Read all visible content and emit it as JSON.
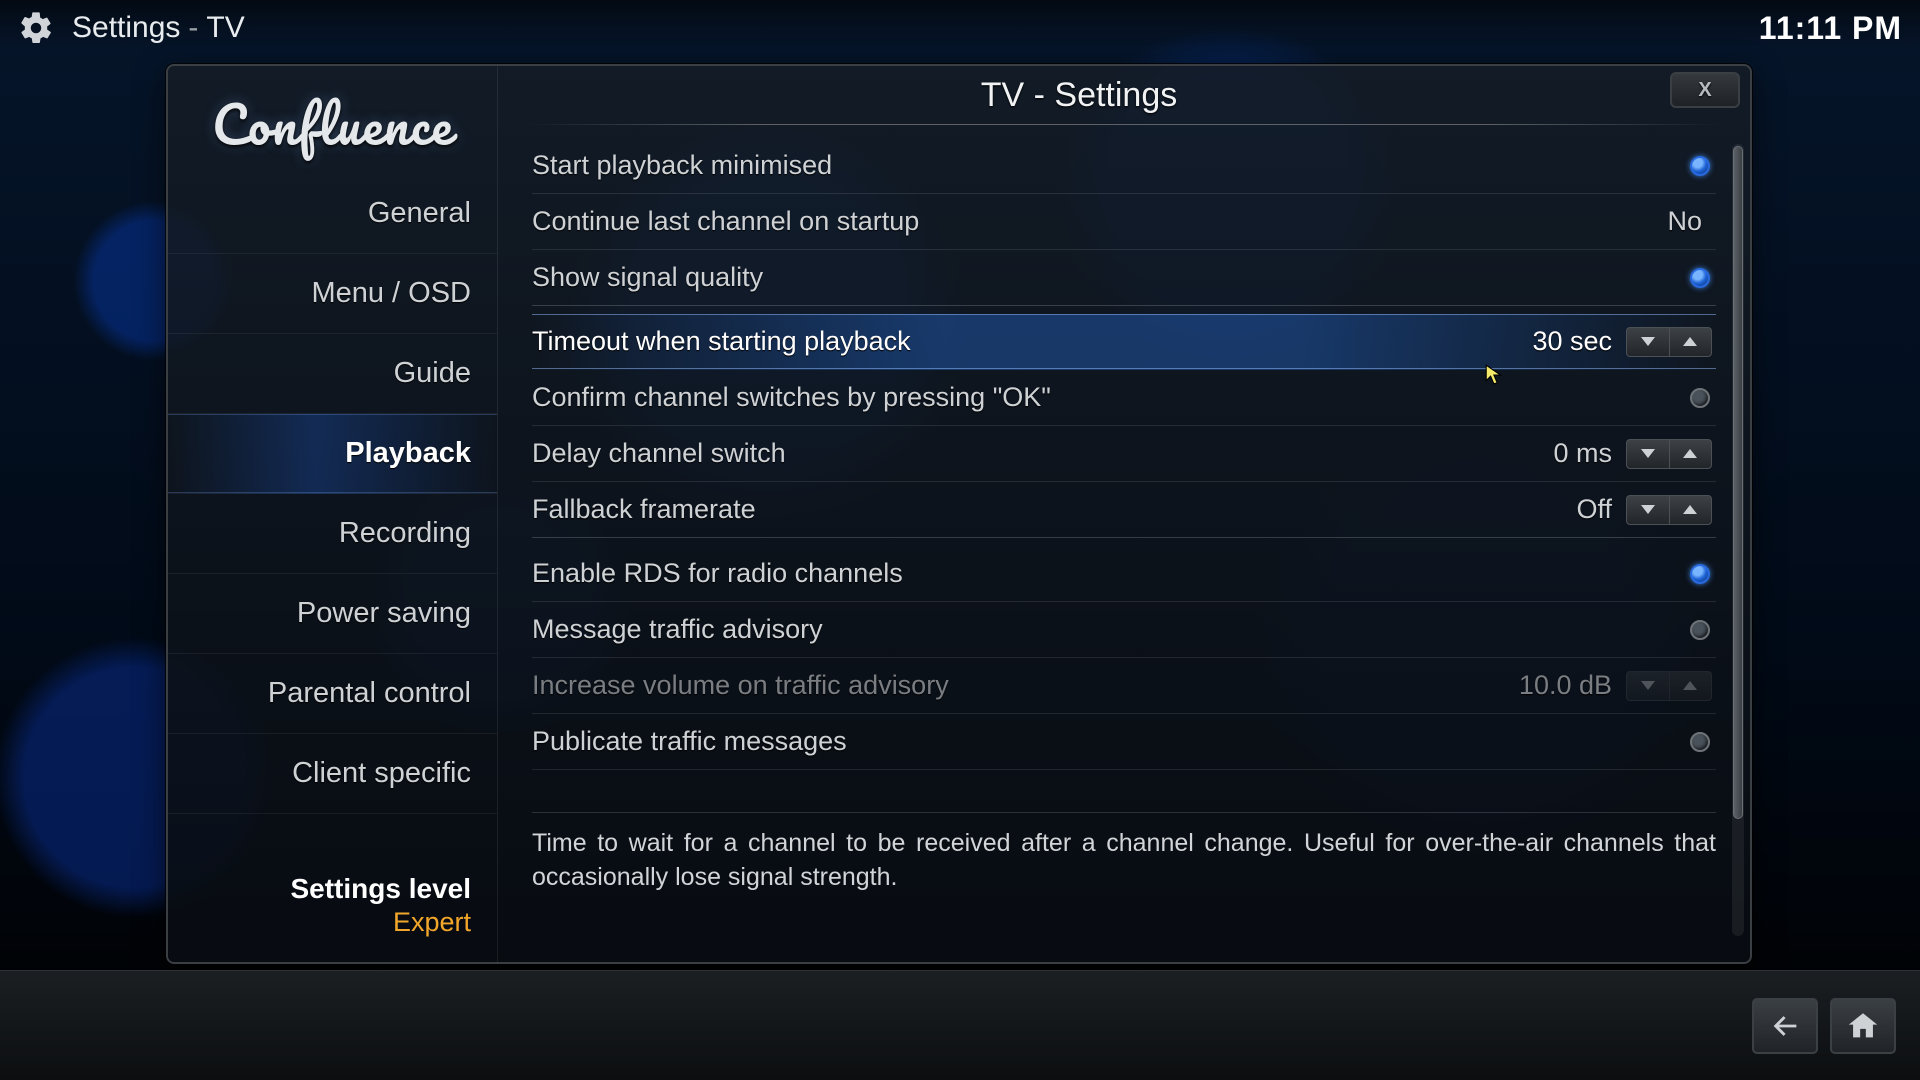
{
  "header": {
    "crumb_main": "Settings",
    "crumb_sub": "TV",
    "clock": "11:11 PM"
  },
  "window": {
    "title": "TV - Settings",
    "brand": "Confluence"
  },
  "sidebar": {
    "items": [
      {
        "label": "General"
      },
      {
        "label": "Menu / OSD"
      },
      {
        "label": "Guide"
      },
      {
        "label": "Playback"
      },
      {
        "label": "Recording"
      },
      {
        "label": "Power saving"
      },
      {
        "label": "Parental control"
      },
      {
        "label": "Client specific"
      }
    ],
    "active_index": 3,
    "settings_level": {
      "label": "Settings level",
      "value": "Expert"
    }
  },
  "settings": {
    "rows": [
      {
        "label": "Start playback minimised",
        "kind": "toggle",
        "on": true
      },
      {
        "label": "Continue last channel on startup",
        "kind": "value",
        "value": "No"
      },
      {
        "label": "Show signal quality",
        "kind": "toggle",
        "on": true,
        "gap_after": true
      },
      {
        "label": "Timeout when starting playback",
        "kind": "spinner",
        "value": "30 sec",
        "hover": true
      },
      {
        "label": "Confirm channel switches by pressing \"OK\"",
        "kind": "toggle",
        "on": false
      },
      {
        "label": "Delay channel switch",
        "kind": "spinner",
        "value": "0 ms"
      },
      {
        "label": "Fallback framerate",
        "kind": "spinner",
        "value": "Off",
        "gap_after": true
      },
      {
        "label": "Enable RDS for radio channels",
        "kind": "toggle",
        "on": true
      },
      {
        "label": "Message traffic advisory",
        "kind": "toggle",
        "on": false
      },
      {
        "label": "Increase volume on traffic advisory",
        "kind": "spinner",
        "value": "10.0 dB",
        "disabled": true
      },
      {
        "label": "Publicate traffic messages",
        "kind": "toggle",
        "on": false
      }
    ],
    "hover_index": 3
  },
  "description": "Time to wait for a channel to be received after a channel change. Useful for over-the-air channels that occasionally lose signal strength.",
  "icons": {
    "close": "X"
  }
}
